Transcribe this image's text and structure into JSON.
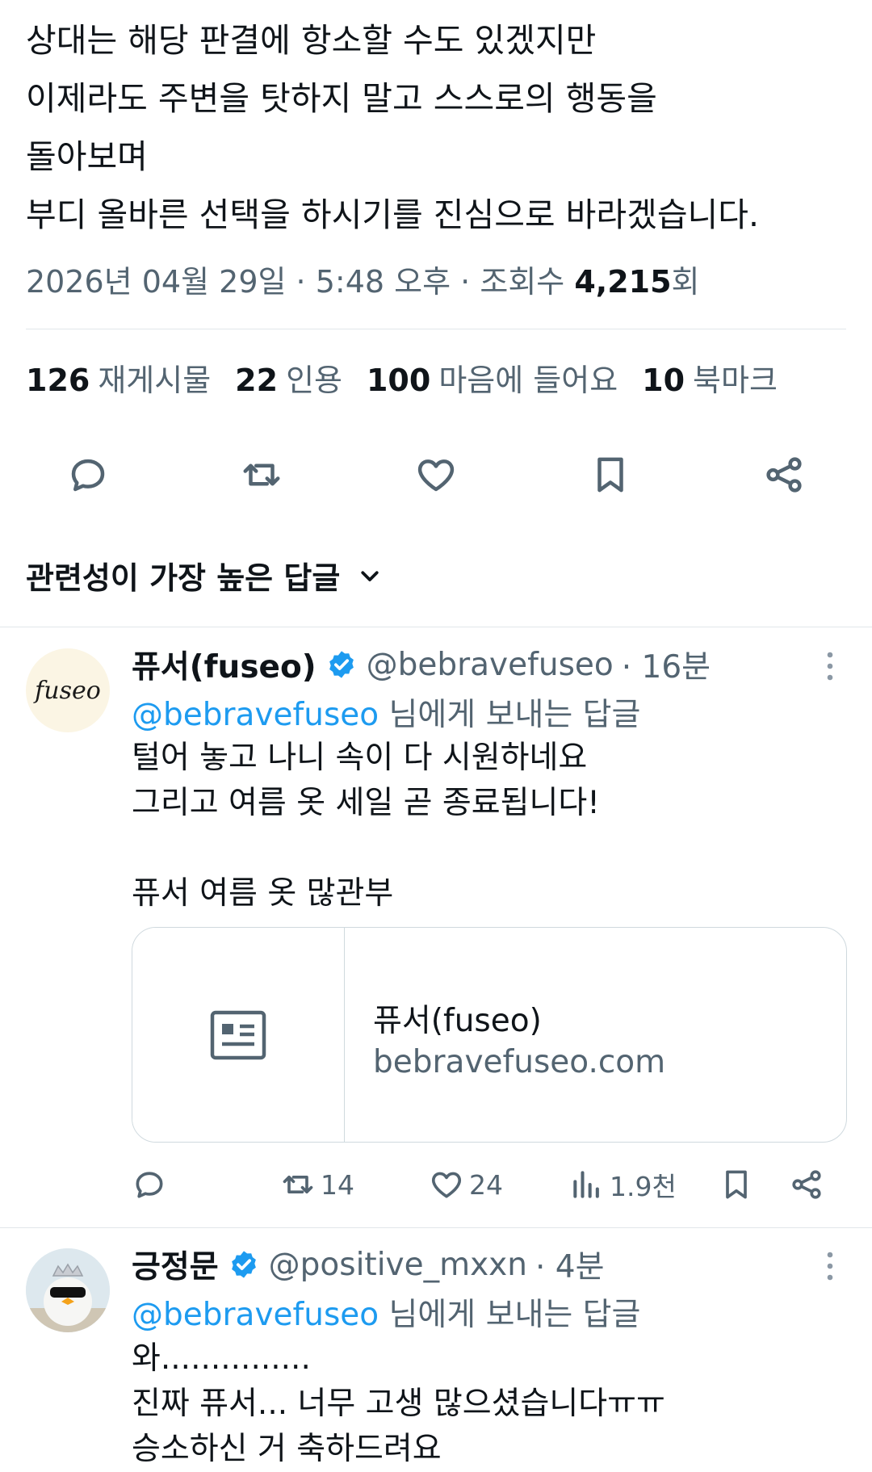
{
  "tweet": {
    "lines": [
      "상대는 해당 판결에 항소할 수도 있겠지만",
      "이제라도 주변을 탓하지 말고 스스로의 행동을",
      "돌아보며",
      "부디 올바른 선택을 하시기를 진심으로 바라겠습니다."
    ],
    "date": "2026년 04월 29일",
    "time": "5:48 오후",
    "views_label": "조회수",
    "views_count": "4,215",
    "views_suffix": "회",
    "sep": "·"
  },
  "stats": [
    {
      "num": "126",
      "label": "재게시물"
    },
    {
      "num": "22",
      "label": "인용"
    },
    {
      "num": "100",
      "label": "마음에 들어요"
    },
    {
      "num": "10",
      "label": "북마크"
    }
  ],
  "actions": [
    "reply-icon",
    "repost-icon",
    "like-icon",
    "bookmark-icon",
    "share-icon"
  ],
  "sort": {
    "label": "관련성이 가장 높은 답글"
  },
  "replies": [
    {
      "name": "퓨서(fuseo)",
      "handle": "@bebravefuseo",
      "time": "· 16분",
      "avatar_text": "fuseo",
      "replying_mention": "@bebravefuseo",
      "replying_text": " 님에게 보내는 답글",
      "text": [
        "털어 놓고 나니 속이 다 시원하네요",
        "그리고 여름 옷 세일 곧 종료됩니다!",
        "",
        "퓨서 여름 옷 많관부"
      ],
      "card": {
        "title": "퓨서(fuseo)",
        "domain": "bebravefuseo.com"
      },
      "counts": {
        "reposts": "14",
        "likes": "24",
        "views": "1.9천"
      }
    },
    {
      "name": "긍정문",
      "handle": "@positive_mxxn",
      "time": "· 4분",
      "replying_mention": "@bebravefuseo",
      "replying_text": " 님에게 보내는 답글",
      "text": [
        "와...............",
        "진짜 퓨서... 너무 고생 많으셨습니다ㅠㅠ",
        "승소하신 거 축하드려요"
      ]
    }
  ],
  "colors": {
    "accent": "#1d9bf0",
    "secondary": "#536471",
    "border": "#cfd9de"
  }
}
